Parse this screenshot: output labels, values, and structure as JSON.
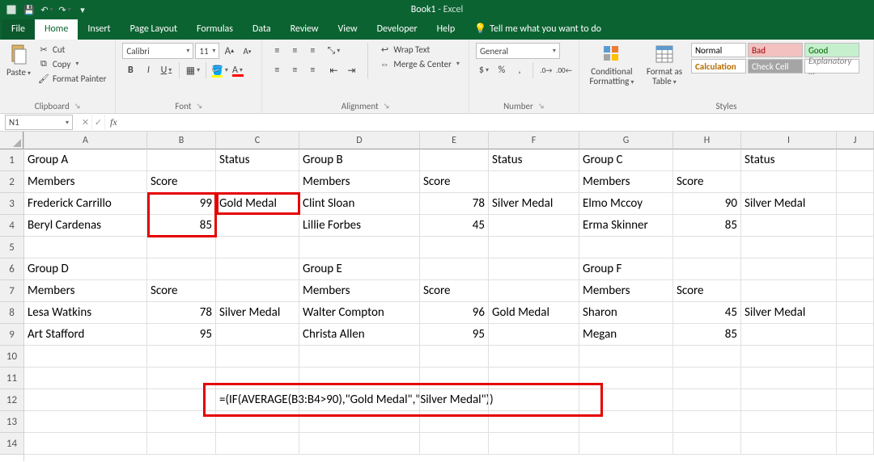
{
  "app": {
    "title": "Book1",
    "subtitle": "Excel"
  },
  "tabs": {
    "file": "File",
    "home": "Home",
    "insert": "Insert",
    "pageLayout": "Page Layout",
    "formulas": "Formulas",
    "data": "Data",
    "review": "Review",
    "view": "View",
    "developer": "Developer",
    "help": "Help",
    "tellme": "Tell me what you want to do"
  },
  "ribbon": {
    "clipboard": {
      "label": "Clipboard",
      "paste": "Paste",
      "cut": "Cut",
      "copy": "Copy",
      "formatPainter": "Format Painter"
    },
    "font": {
      "label": "Font",
      "name": "Calibri",
      "size": "11",
      "bold": "B",
      "italic": "I",
      "underline": "U"
    },
    "alignment": {
      "label": "Alignment",
      "wrap": "Wrap Text",
      "merge": "Merge & Center"
    },
    "number": {
      "label": "Number",
      "format": "General"
    },
    "styles": {
      "label": "Styles",
      "conditional": "Conditional Formatting",
      "formatAs": "Format as Table",
      "normal": "Normal",
      "bad": "Bad",
      "good": "Good",
      "calc": "Calculation",
      "check": "Check Cell",
      "explan": "Explanatory ..."
    }
  },
  "formulaBar": {
    "name": "N1",
    "value": ""
  },
  "columns": [
    "A",
    "B",
    "C",
    "D",
    "E",
    "F",
    "G",
    "H",
    "I",
    "J"
  ],
  "rows": [
    "1",
    "2",
    "3",
    "4",
    "5",
    "6",
    "7",
    "8",
    "9",
    "10",
    "11",
    "12",
    "13",
    "14"
  ],
  "grid": {
    "r1": {
      "A": "Group A",
      "C": "Status",
      "D": "Group B",
      "F": "Status",
      "G": "Group C",
      "I": "Status"
    },
    "r2": {
      "A": "Members",
      "B": "Score",
      "D": "Members",
      "E": "Score",
      "G": "Members",
      "H": "Score"
    },
    "r3": {
      "A": "Frederick Carrillo",
      "B": "99",
      "C": "Gold Medal",
      "D": "Clint Sloan",
      "E": "78",
      "F": "Silver Medal",
      "G": "Elmo Mccoy",
      "H": "90",
      "I": "Silver Medal"
    },
    "r4": {
      "A": "Beryl Cardenas",
      "B": "85",
      "D": "Lillie Forbes",
      "E": "45",
      "G": "Erma Skinner",
      "H": "85"
    },
    "r6": {
      "A": "Group D",
      "D": "Group E",
      "G": "Group F"
    },
    "r7": {
      "A": "Members",
      "B": "Score",
      "D": "Members",
      "E": "Score",
      "G": "Members",
      "H": "Score"
    },
    "r8": {
      "A": "Lesa Watkins",
      "B": "78",
      "C": "Silver Medal",
      "D": "Walter Compton",
      "E": "96",
      "F": "Gold Medal",
      "G": "Sharon",
      "H": "45",
      "I": "Silver Medal"
    },
    "r9": {
      "A": "Art Stafford",
      "B": "95",
      "D": "Christa Allen",
      "E": "95",
      "G": "Megan",
      "H": "85"
    },
    "r12": {
      "C": "=(IF(AVERAGE(B3:B4>90),\"Gold Medal\",\"Silver Medal\"))"
    }
  }
}
